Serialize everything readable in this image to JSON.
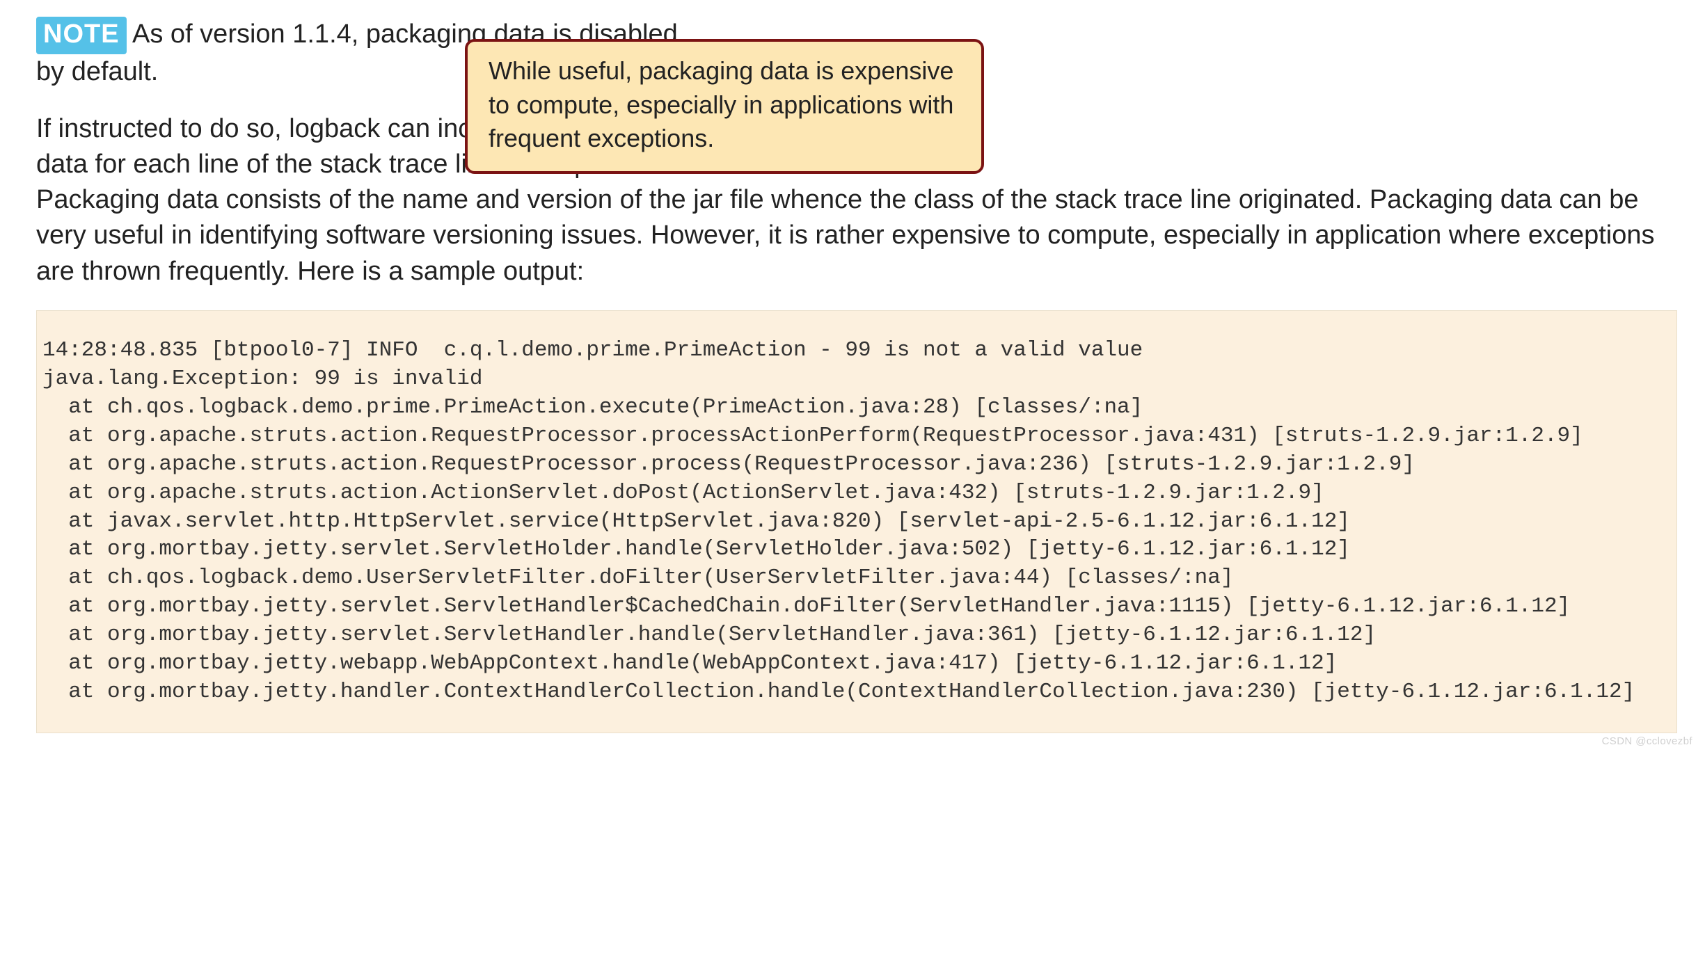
{
  "note": {
    "badge": "NOTE",
    "lead": "As of version 1.1.4, packaging data is disabled by default.",
    "para2": "If instructed to do so, logback can include packaging data for each line of the stack trace lines it outputs.",
    "para3": "Packaging data consists of the name and version of the jar file whence the class of the stack trace line originated. Packaging data can be very useful in identifying software versioning issues. However, it is rather expensive to compute, especially in application where exceptions are thrown frequently. Here is a sample output:"
  },
  "callout": {
    "text": "While useful, packaging data is expensive to compute, especially in applications with frequent exceptions."
  },
  "code": {
    "lines": [
      "14:28:48.835 [btpool0-7] INFO  c.q.l.demo.prime.PrimeAction - 99 is not a valid value",
      "java.lang.Exception: 99 is invalid",
      "  at ch.qos.logback.demo.prime.PrimeAction.execute(PrimeAction.java:28) [classes/:na]",
      "  at org.apache.struts.action.RequestProcessor.processActionPerform(RequestProcessor.java:431) [struts-1.2.9.jar:1.2.9]",
      "  at org.apache.struts.action.RequestProcessor.process(RequestProcessor.java:236) [struts-1.2.9.jar:1.2.9]",
      "  at org.apache.struts.action.ActionServlet.doPost(ActionServlet.java:432) [struts-1.2.9.jar:1.2.9]",
      "  at javax.servlet.http.HttpServlet.service(HttpServlet.java:820) [servlet-api-2.5-6.1.12.jar:6.1.12]",
      "  at org.mortbay.jetty.servlet.ServletHolder.handle(ServletHolder.java:502) [jetty-6.1.12.jar:6.1.12]",
      "  at ch.qos.logback.demo.UserServletFilter.doFilter(UserServletFilter.java:44) [classes/:na]",
      "  at org.mortbay.jetty.servlet.ServletHandler$CachedChain.doFilter(ServletHandler.java:1115) [jetty-6.1.12.jar:6.1.12]",
      "  at org.mortbay.jetty.servlet.ServletHandler.handle(ServletHandler.java:361) [jetty-6.1.12.jar:6.1.12]",
      "  at org.mortbay.jetty.webapp.WebAppContext.handle(WebAppContext.java:417) [jetty-6.1.12.jar:6.1.12]",
      "  at org.mortbay.jetty.handler.ContextHandlerCollection.handle(ContextHandlerCollection.java:230) [jetty-6.1.12.jar:6.1.12]"
    ]
  },
  "watermark": "CSDN @cclovezbf"
}
